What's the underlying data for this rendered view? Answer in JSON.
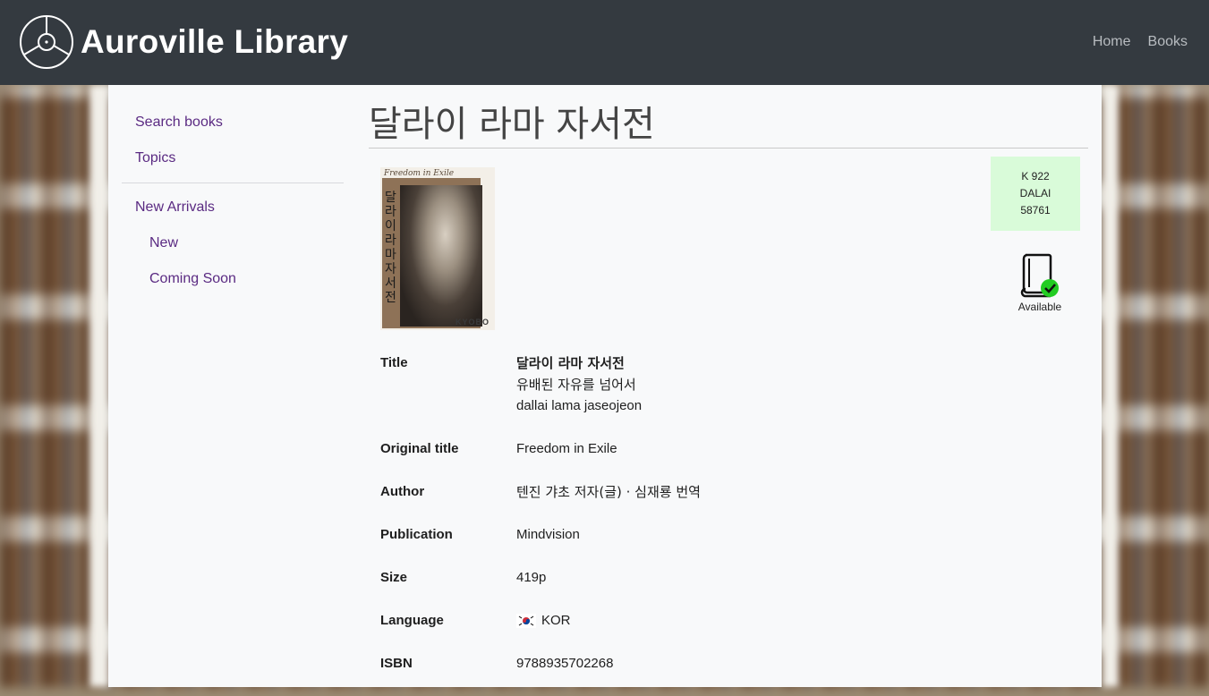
{
  "header": {
    "brand": "Auroville Library",
    "nav": [
      "Home",
      "Books"
    ]
  },
  "sidebar": {
    "items": [
      {
        "label": "Search books",
        "level": 0
      },
      {
        "label": "Topics",
        "level": 0
      },
      {
        "label": "New Arrivals",
        "level": 0
      },
      {
        "label": "New",
        "level": 1
      },
      {
        "label": "Coming Soon",
        "level": 1
      }
    ]
  },
  "book": {
    "page_title": "달라이 라마 자서전",
    "cover": {
      "top_text": "Freedom in Exile",
      "vertical_text": "달라이라마자서전",
      "publisher_mark": "KYOBO"
    },
    "call_number": [
      "K 922",
      "DALAI",
      "58761"
    ],
    "availability": "Available",
    "fields": {
      "title_label": "Title",
      "title_main": "달라이 라마 자서전",
      "title_sub": "유배된 자유를 넘어서",
      "title_roman": "dallai lama jaseojeon",
      "original_title_label": "Original title",
      "original_title": "Freedom in Exile",
      "author_label": "Author",
      "author": "텐진 갸초 저자(글) · 심재룡 번역",
      "publication_label": "Publication",
      "publication": "Mindvision",
      "size_label": "Size",
      "size": "419p",
      "language_label": "Language",
      "language": "KOR",
      "isbn_label": "ISBN",
      "isbn": "9788935702268"
    }
  },
  "colors": {
    "topbar": "#343a40",
    "link": "#5a2a82",
    "callno_bg": "#d9fbd9",
    "available_check": "#22cc22"
  }
}
